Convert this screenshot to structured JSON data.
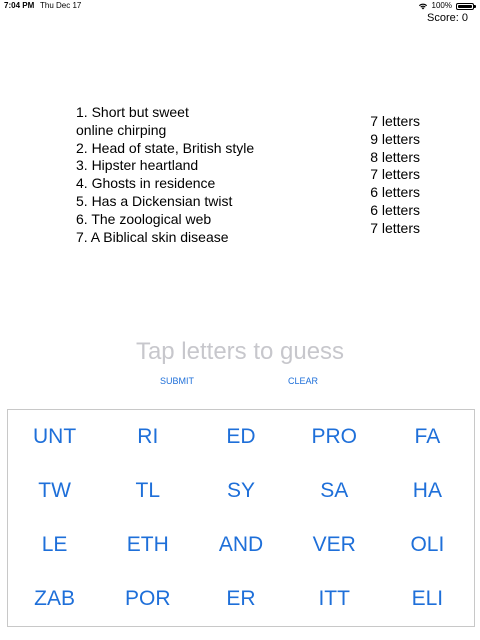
{
  "status_bar": {
    "time": "7:04 PM",
    "date": "Thu Dec 17",
    "battery_percent_label": "100%",
    "battery_level": 1.0
  },
  "score_label": "Score: 0",
  "clues": [
    "1. Short but sweet",
    "online chirping",
    "2. Head of state, British style",
    "3. Hipster heartland",
    "4. Ghosts in residence",
    "5. Has a Dickensian twist",
    "6. The zoological web",
    "7. A Biblical skin disease"
  ],
  "lengths": [
    "7 letters",
    "9 letters",
    "8 letters",
    "7 letters",
    "6 letters",
    "6 letters",
    "7 letters"
  ],
  "guess_placeholder": "Tap letters to guess",
  "buttons": {
    "submit": "SUBMIT",
    "clear": "CLEAR"
  },
  "tiles": [
    "UNT",
    "RI",
    "ED",
    "PRO",
    "FA",
    "TW",
    "TL",
    "SY",
    "SA",
    "HA",
    "LE",
    "ETH",
    "AND",
    "VER",
    "OLI",
    "ZAB",
    "POR",
    "ER",
    "ITT",
    "ELI"
  ],
  "colors": {
    "accent": "#1e6fd9",
    "placeholder": "#c7c7cc",
    "panel_border": "#c8c8c8"
  },
  "icons": {
    "wifi": "wifi-icon",
    "battery": "battery-icon"
  }
}
